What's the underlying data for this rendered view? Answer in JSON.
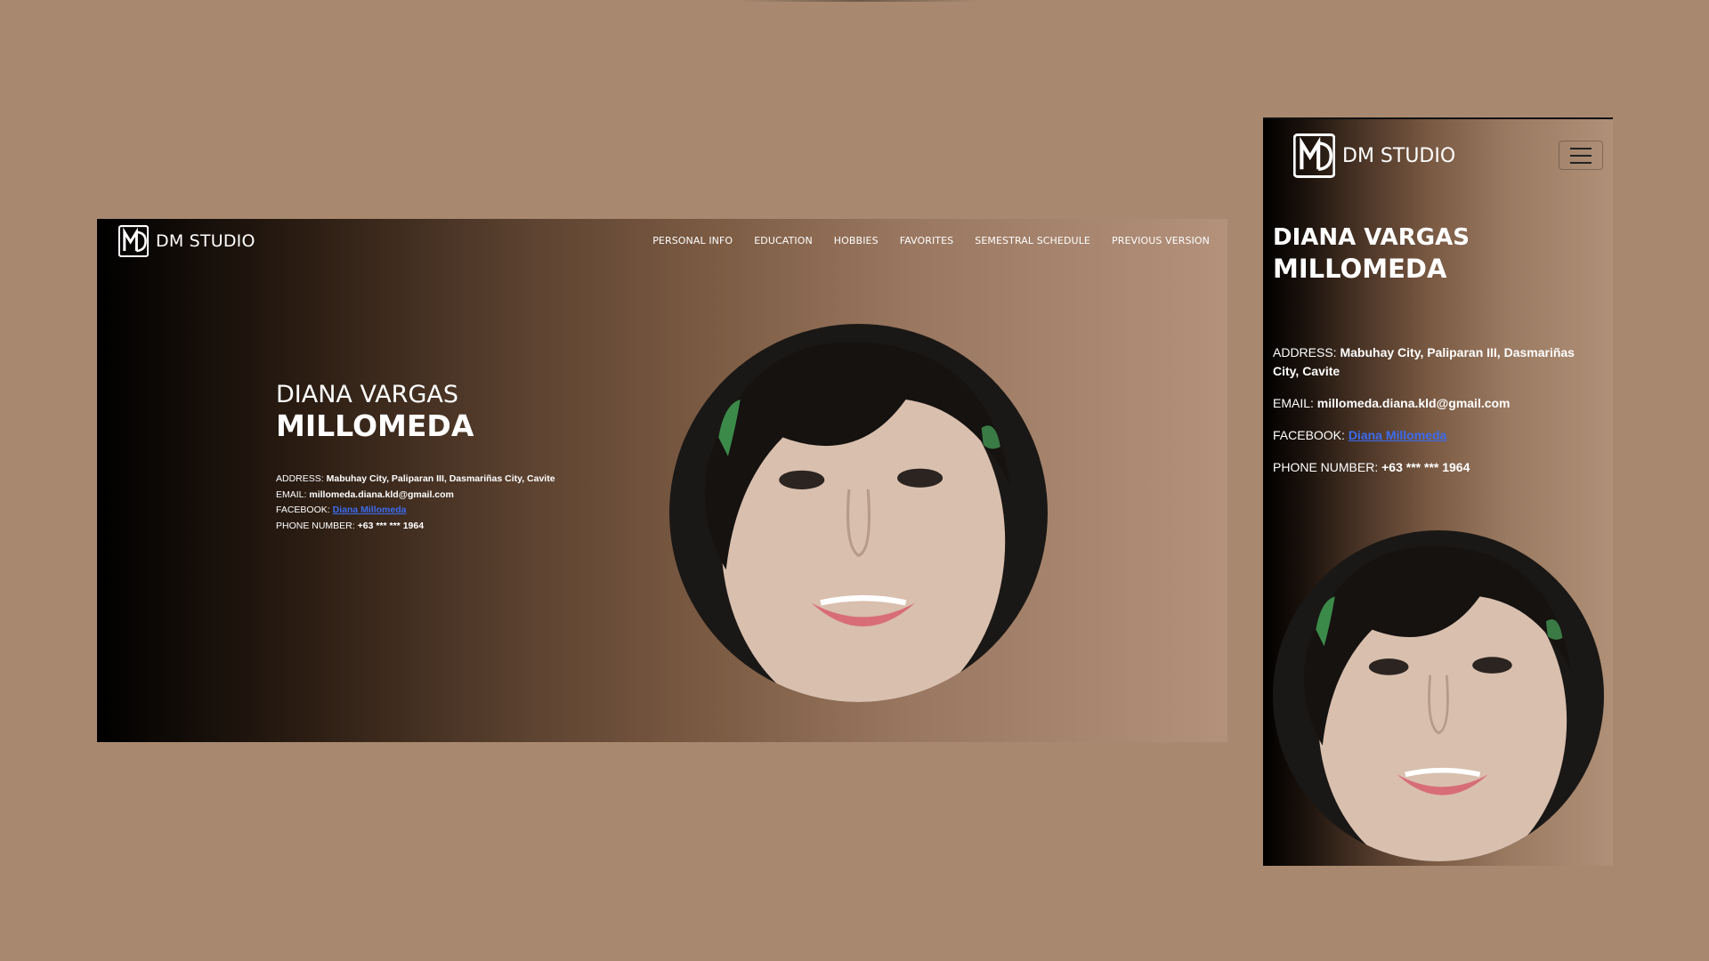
{
  "brand": "DM STUDIO",
  "desktop": {
    "nav": [
      "PERSONAL INFO",
      "EDUCATION",
      "HOBBIES",
      "FAVORITES",
      "SEMESTRAL SCHEDULE",
      "PREVIOUS VERSION"
    ],
    "name_line1": "DIANA VARGAS",
    "name_line2": "MILLOMEDA",
    "address_label": "ADDRESS:",
    "address": "Mabuhay City, Paliparan III, Dasmariñas City, Cavite",
    "email_label": "EMAIL:",
    "email": "millomeda.diana.kld@gmail.com",
    "facebook_label": "FACEBOOK:",
    "facebook": "Diana Millomeda",
    "phone_label": "PHONE NUMBER:",
    "phone": "+63 *** *** 1964"
  },
  "mobile": {
    "name_line1": "DIANA VARGAS",
    "name_line2": "MILLOMEDA",
    "address_label": "ADDRESS:",
    "address": "Mabuhay City, Paliparan III, Dasmariñas City, Cavite",
    "email_label": "EMAIL:",
    "email": "millomeda.diana.kld@gmail.com",
    "facebook_label": "FACEBOOK:",
    "facebook": "Diana Millomeda",
    "phone_label": "PHONE NUMBER:",
    "phone": "+63 *** *** 1964"
  },
  "icons": {
    "logo": "dm-monogram-icon",
    "menu": "hamburger-menu-icon",
    "photo": "profile-photo"
  }
}
